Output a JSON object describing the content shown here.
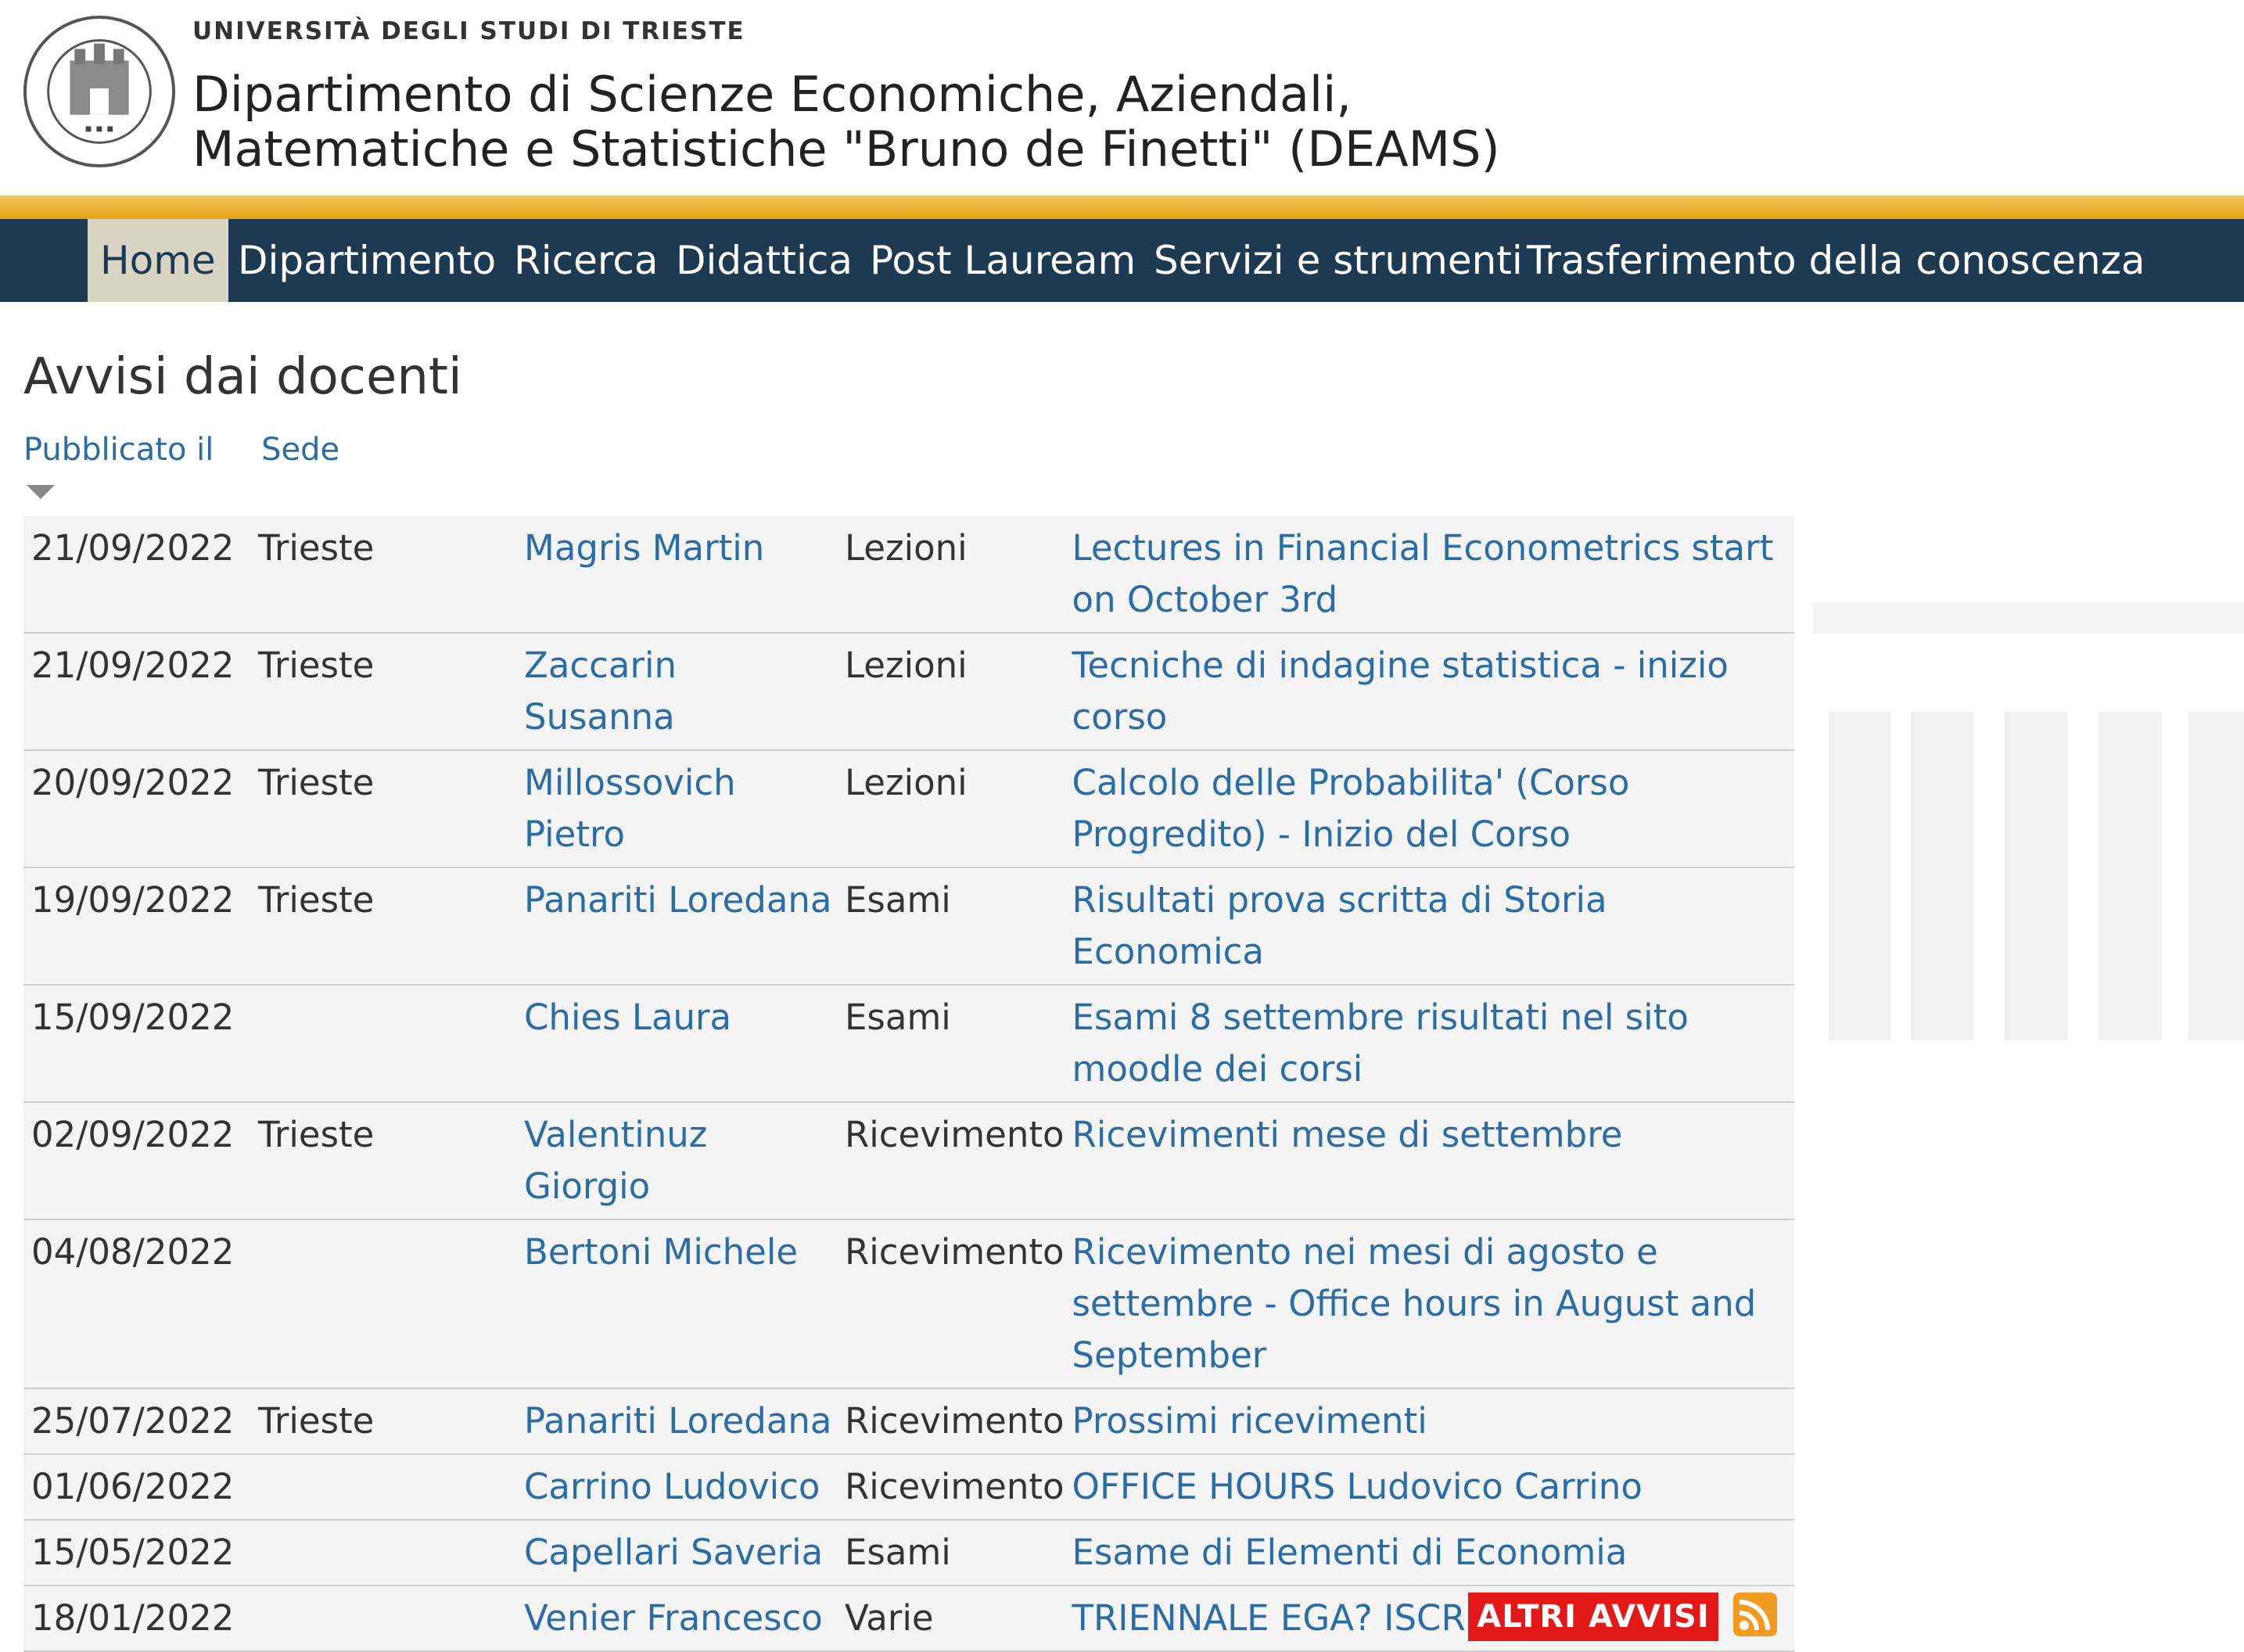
{
  "header": {
    "university": "UNIVERSITÀ DEGLI STUDI DI TRIESTE",
    "department_line1": "Dipartimento di Scienze Economiche, Aziendali,",
    "department_line2": "Matematiche e Statistiche \"Bruno de Finetti\" (DEAMS)",
    "logo_icon": "university-seal"
  },
  "nav": {
    "items": [
      "Home",
      "Dipartimento",
      "Ricerca",
      "Didattica",
      "Post Lauream",
      "Servizi e strumenti",
      "Trasferimento della conoscenza"
    ],
    "active": "Home"
  },
  "main": {
    "title": "Avvisi dai docenti",
    "sort": {
      "published": "Pubblicato il",
      "location": "Sede"
    },
    "notices": [
      {
        "date": "21/09/2022",
        "sede": "Trieste",
        "docente": "Magris Martin",
        "categoria": "Lezioni",
        "titolo": "Lectures in Financial Econometrics start on October 3rd"
      },
      {
        "date": "21/09/2022",
        "sede": "Trieste",
        "docente": "Zaccarin Susanna",
        "categoria": "Lezioni",
        "titolo": "Tecniche di indagine statistica - inizio corso"
      },
      {
        "date": "20/09/2022",
        "sede": "Trieste",
        "docente": "Millossovich Pietro",
        "categoria": "Lezioni",
        "titolo": "Calcolo delle Probabilita' (Corso Progredito) - Inizio del Corso"
      },
      {
        "date": "19/09/2022",
        "sede": "Trieste",
        "docente": "Panariti Loredana",
        "categoria": "Esami",
        "titolo": "Risultati prova scritta di Storia Economica"
      },
      {
        "date": "15/09/2022",
        "sede": "",
        "docente": "Chies Laura",
        "categoria": "Esami",
        "titolo": "Esami 8 settembre risultati nel sito moodle dei corsi"
      },
      {
        "date": "02/09/2022",
        "sede": "Trieste",
        "docente": "Valentinuz Giorgio",
        "categoria": "Ricevimento",
        "titolo": "Ricevimenti mese di settembre"
      },
      {
        "date": "04/08/2022",
        "sede": "",
        "docente": "Bertoni Michele",
        "categoria": "Ricevimento",
        "titolo": "Ricevimento nei mesi di agosto e settembre - Office hours in August and September"
      },
      {
        "date": "25/07/2022",
        "sede": "Trieste",
        "docente": "Panariti Loredana",
        "categoria": "Ricevimento",
        "titolo": "Prossimi ricevimenti"
      },
      {
        "date": "01/06/2022",
        "sede": "",
        "docente": "Carrino Ludovico",
        "categoria": "Ricevimento",
        "titolo": "OFFICE HOURS Ludovico Carrino"
      },
      {
        "date": "15/05/2022",
        "sede": "",
        "docente": "Capellari Saveria",
        "categoria": "Esami",
        "titolo": "Esame di Elementi di Economia"
      },
      {
        "date": "18/01/2022",
        "sede": "",
        "docente": "Venier Francesco",
        "categoria": "Varie",
        "titolo": "TRIENNALE EGA? ISCRIVITI AL TEAM"
      }
    ],
    "more_button": "ALTRI AVVISI",
    "feed_icon": "rss-icon"
  },
  "colors": {
    "nav_bg": "#1e3a52",
    "accent_gold": "#e3a212",
    "link": "#2a6ca8",
    "button_red": "#e31818"
  }
}
